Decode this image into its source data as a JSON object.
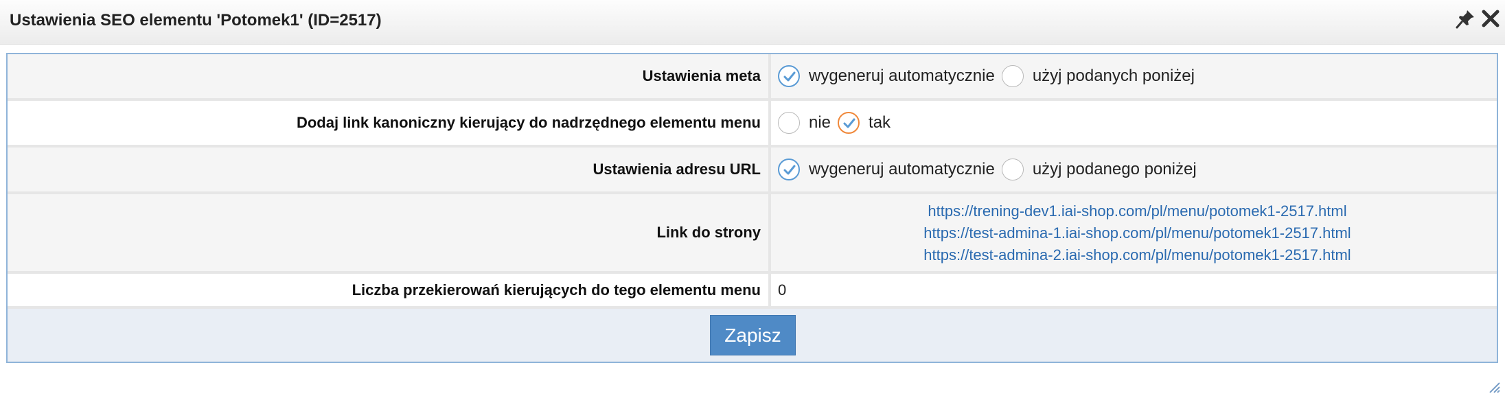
{
  "dialog": {
    "title": "Ustawienia SEO elementu 'Potomek1' (ID=2517)",
    "icons": [
      "pin-icon",
      "close-icon"
    ]
  },
  "form": {
    "meta": {
      "label": "Ustawienia meta",
      "options": [
        "wygeneruj automatycznie",
        "użyj podanych poniżej"
      ],
      "selected": "wygeneruj automatycznie"
    },
    "canonical": {
      "label": "Dodaj link kanoniczny kierujący do nadrzędnego elementu menu",
      "options": [
        "nie",
        "tak"
      ],
      "selected": "tak"
    },
    "url": {
      "label": "Ustawienia adresu URL",
      "options": [
        "wygeneruj automatycznie",
        "użyj podanego poniżej"
      ],
      "selected": "wygeneruj automatycznie"
    },
    "links": {
      "label": "Link do strony",
      "items": [
        "https://trening-dev1.iai-shop.com/pl/menu/potomek1-2517.html",
        "https://test-admina-1.iai-shop.com/pl/menu/potomek1-2517.html",
        "https://test-admina-2.iai-shop.com/pl/menu/potomek1-2517.html"
      ]
    },
    "redirects": {
      "label": "Liczba przekierowań kierujących do tego elementu menu",
      "value": "0"
    }
  },
  "footer": {
    "save_label": "Zapisz"
  },
  "colors": {
    "accent_blue": "#4f8ac6",
    "check_orange": "#f0883a",
    "link": "#2a6ab0"
  }
}
